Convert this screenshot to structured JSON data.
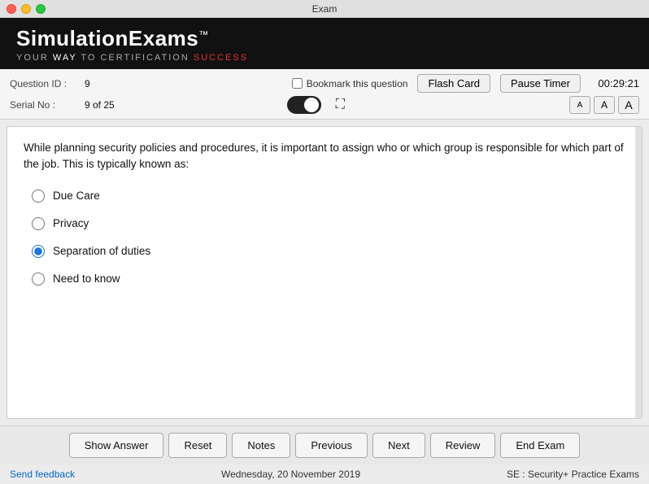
{
  "titlebar": {
    "title": "Exam"
  },
  "brand": {
    "name": "SimulationExams",
    "tm": "™",
    "tagline_before": "YOUR ",
    "tagline_way": "WAY",
    "tagline_middle": " TO CERTIFICATION ",
    "tagline_accent": "SUCCESS"
  },
  "info": {
    "question_id_label": "Question ID :",
    "question_id_value": "9",
    "serial_no_label": "Serial No :",
    "serial_no_value": "9 of 25",
    "bookmark_label": "Bookmark this question",
    "flashcard_label": "Flash Card",
    "pause_label": "Pause Timer",
    "timer": "00:29:21",
    "font_a_small": "A",
    "font_a_medium": "A",
    "font_a_large": "A"
  },
  "question": {
    "text": "While planning security policies and procedures, it is important to assign who or which group is responsible for which part of the job. This is typically known as:",
    "options": [
      {
        "id": "opt1",
        "label": "Due Care",
        "selected": false
      },
      {
        "id": "opt2",
        "label": "Privacy",
        "selected": false
      },
      {
        "id": "opt3",
        "label": "Separation of duties",
        "selected": true
      },
      {
        "id": "opt4",
        "label": "Need to know",
        "selected": false
      }
    ]
  },
  "buttons": {
    "show_answer": "Show Answer",
    "reset": "Reset",
    "notes": "Notes",
    "previous": "Previous",
    "next": "Next",
    "review": "Review",
    "end_exam": "End Exam"
  },
  "footer": {
    "feedback": "Send feedback",
    "date": "Wednesday, 20 November 2019",
    "brand": "SE : Security+ Practice Exams"
  }
}
